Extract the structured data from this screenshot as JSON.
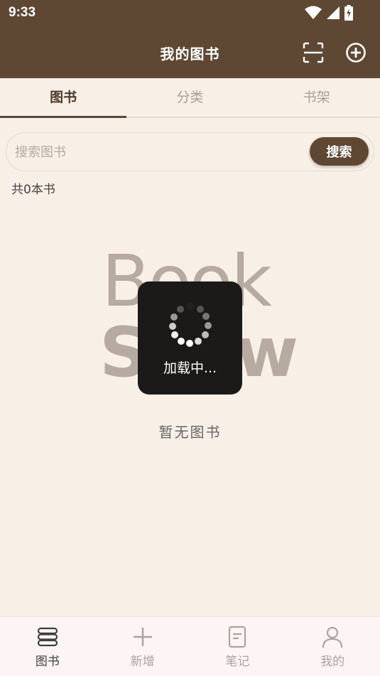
{
  "status_bar": {
    "time": "9:33"
  },
  "app_bar": {
    "title": "我的图书"
  },
  "tabs": [
    {
      "label": "图书",
      "active": true
    },
    {
      "label": "分类",
      "active": false
    },
    {
      "label": "书架",
      "active": false
    }
  ],
  "search": {
    "placeholder": "搜索图书",
    "value": "",
    "button_label": "搜索"
  },
  "book_count_text": "共0本书",
  "empty_state": {
    "logo_line1": "Book",
    "logo_line2": "Show",
    "message": "暂无图书"
  },
  "loading": {
    "text": "加载中..."
  },
  "bottom_nav": [
    {
      "label": "图书",
      "icon": "books-icon",
      "active": true
    },
    {
      "label": "新增",
      "icon": "plus-icon",
      "active": false
    },
    {
      "label": "笔记",
      "icon": "note-icon",
      "active": false
    },
    {
      "label": "我的",
      "icon": "person-icon",
      "active": false
    }
  ],
  "colors": {
    "primary": "#5e4834",
    "background": "#f8efe6",
    "nav_background": "#fdf5f5"
  }
}
